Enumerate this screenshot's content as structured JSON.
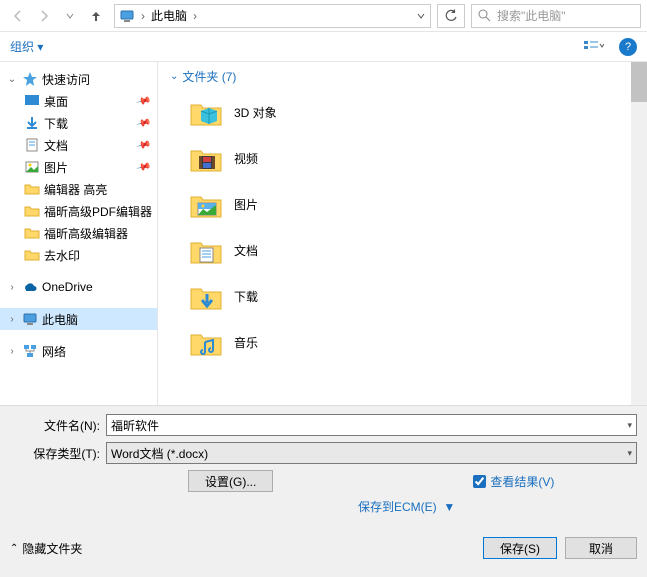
{
  "nav": {
    "breadcrumb_root": "此电脑",
    "search_placeholder": "搜索\"此电脑\""
  },
  "subbar": {
    "organize": "组织",
    "help": "?"
  },
  "tree": {
    "quick_access": "快速访问",
    "items": [
      {
        "label": "桌面",
        "icon": "desktop"
      },
      {
        "label": "下载",
        "icon": "downloads"
      },
      {
        "label": "文档",
        "icon": "documents"
      },
      {
        "label": "图片",
        "icon": "pictures"
      },
      {
        "label": "编辑器 高亮",
        "icon": "folder"
      },
      {
        "label": "福昕高级PDF编辑器",
        "icon": "folder"
      },
      {
        "label": "福昕高级编辑器",
        "icon": "folder"
      },
      {
        "label": "去水印",
        "icon": "folder"
      }
    ],
    "onedrive": "OneDrive",
    "thispc": "此电脑",
    "network": "网络"
  },
  "content": {
    "group_label": "文件夹 (7)",
    "folders": [
      {
        "label": "3D 对象",
        "icon": "3d"
      },
      {
        "label": "视频",
        "icon": "video"
      },
      {
        "label": "图片",
        "icon": "pictures"
      },
      {
        "label": "文档",
        "icon": "documents"
      },
      {
        "label": "下载",
        "icon": "downloads"
      },
      {
        "label": "音乐",
        "icon": "music"
      }
    ]
  },
  "bottom": {
    "filename_label": "文件名(N):",
    "filename_value": "福昕软件",
    "filetype_label": "保存类型(T):",
    "filetype_value": "Word文档 (*.docx)",
    "settings_btn": "设置(G)...",
    "view_result": "查看结果(V)",
    "save_ecm": "保存到ECM(E)",
    "hide_folders": "隐藏文件夹",
    "save_btn": "保存(S)",
    "cancel_btn": "取消"
  }
}
